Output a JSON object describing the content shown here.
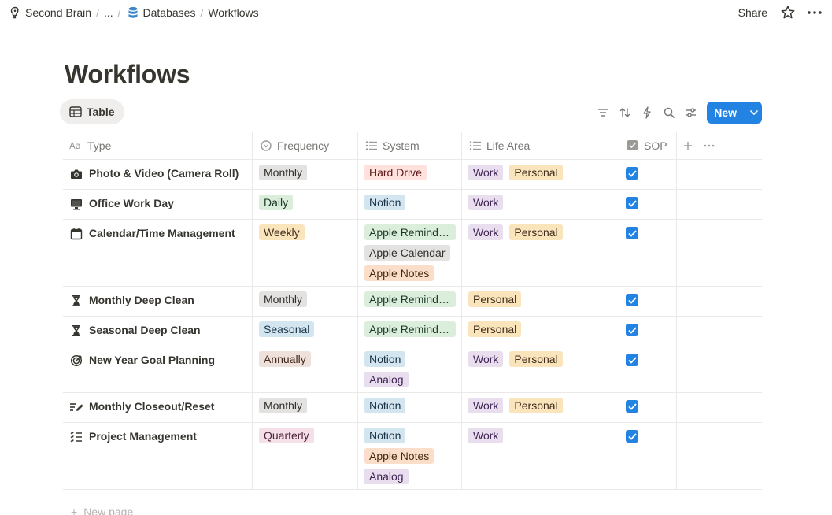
{
  "breadcrumb": {
    "workspace": "Second Brain",
    "ellipsis": "...",
    "databases": "Databases",
    "current": "Workflows"
  },
  "topbar": {
    "share": "Share"
  },
  "page": {
    "title": "Workflows"
  },
  "view": {
    "tab_label": "Table",
    "new_label": "New"
  },
  "columns": [
    "Type",
    "Frequency",
    "System",
    "Life Area",
    "SOP"
  ],
  "colors": {
    "accent": "#2383e2",
    "gray": {
      "bg": "#e3e2e0",
      "fg": "#32302c"
    },
    "green": {
      "bg": "#dbeddb",
      "fg": "#1c3829"
    },
    "yellow": {
      "bg": "#f9e4bc",
      "fg": "#402c1b"
    },
    "blue": {
      "bg": "#d3e5ef",
      "fg": "#183347"
    },
    "brown": {
      "bg": "#eee0da",
      "fg": "#442a1e"
    },
    "pink": {
      "bg": "#f5e0e9",
      "fg": "#4c2337"
    },
    "red": {
      "bg": "#ffe2dd",
      "fg": "#5d1715"
    },
    "purple": {
      "bg": "#e8deee",
      "fg": "#412454"
    },
    "orange": {
      "bg": "#fadec9",
      "fg": "#49290e"
    }
  },
  "rows": [
    {
      "icon": "camera-icon",
      "name": "Photo & Video (Camera Roll)",
      "frequency": {
        "label": "Monthly",
        "color": "gray"
      },
      "system": [
        {
          "label": "Hard Drive",
          "color": "red"
        }
      ],
      "life_area": [
        {
          "label": "Work",
          "color": "purple"
        },
        {
          "label": "Personal",
          "color": "yellow"
        }
      ],
      "sop": true
    },
    {
      "icon": "monitor-icon",
      "name": "Office Work Day",
      "frequency": {
        "label": "Daily",
        "color": "green"
      },
      "system": [
        {
          "label": "Notion",
          "color": "blue"
        }
      ],
      "life_area": [
        {
          "label": "Work",
          "color": "purple"
        }
      ],
      "sop": true
    },
    {
      "icon": "calendar-icon",
      "name": "Calendar/Time Management",
      "frequency": {
        "label": "Weekly",
        "color": "yellow"
      },
      "system": [
        {
          "label": "Apple Reminders",
          "color": "green"
        },
        {
          "label": "Apple Calendar",
          "color": "gray"
        },
        {
          "label": "Apple Notes",
          "color": "orange"
        }
      ],
      "life_area": [
        {
          "label": "Work",
          "color": "purple"
        },
        {
          "label": "Personal",
          "color": "yellow"
        }
      ],
      "sop": true
    },
    {
      "icon": "hourglass-icon",
      "name": "Monthly Deep Clean",
      "frequency": {
        "label": "Monthly",
        "color": "gray"
      },
      "system": [
        {
          "label": "Apple Reminders",
          "color": "green"
        }
      ],
      "life_area": [
        {
          "label": "Personal",
          "color": "yellow"
        }
      ],
      "sop": true
    },
    {
      "icon": "hourglass-icon",
      "name": "Seasonal Deep Clean",
      "frequency": {
        "label": "Seasonal",
        "color": "blue"
      },
      "system": [
        {
          "label": "Apple Reminders",
          "color": "green"
        }
      ],
      "life_area": [
        {
          "label": "Personal",
          "color": "yellow"
        }
      ],
      "sop": true
    },
    {
      "icon": "target-icon",
      "name": "New Year Goal Planning",
      "frequency": {
        "label": "Annually",
        "color": "brown"
      },
      "system": [
        {
          "label": "Notion",
          "color": "blue"
        },
        {
          "label": "Analog",
          "color": "purple"
        }
      ],
      "life_area": [
        {
          "label": "Work",
          "color": "purple"
        },
        {
          "label": "Personal",
          "color": "yellow"
        }
      ],
      "sop": true
    },
    {
      "icon": "edit-list-icon",
      "name": "Monthly Closeout/Reset",
      "frequency": {
        "label": "Monthly",
        "color": "gray"
      },
      "system": [
        {
          "label": "Notion",
          "color": "blue"
        }
      ],
      "life_area": [
        {
          "label": "Work",
          "color": "purple"
        },
        {
          "label": "Personal",
          "color": "yellow"
        }
      ],
      "sop": true
    },
    {
      "icon": "checklist-icon",
      "name": "Project Management",
      "frequency": {
        "label": "Quarterly",
        "color": "pink"
      },
      "system": [
        {
          "label": "Notion",
          "color": "blue"
        },
        {
          "label": "Apple Notes",
          "color": "orange"
        },
        {
          "label": "Analog",
          "color": "purple"
        }
      ],
      "life_area": [
        {
          "label": "Work",
          "color": "purple"
        }
      ],
      "sop": true
    }
  ],
  "footer": {
    "new_page": "New page"
  }
}
